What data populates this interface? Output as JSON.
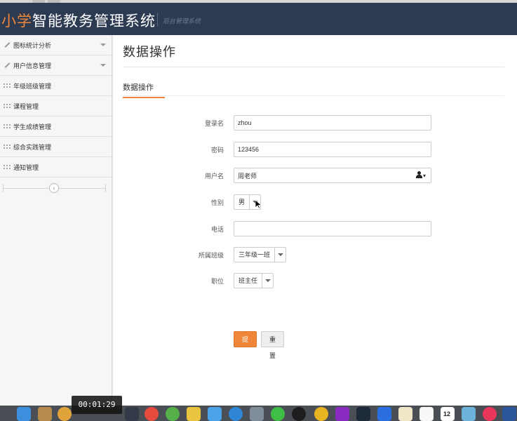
{
  "header": {
    "title_highlight": "小学",
    "title_rest": "智能教务管理系统",
    "subtitle": "后台管理系统"
  },
  "sidebar": {
    "items": [
      {
        "label": "图标统计分析",
        "icon": "pencil-icon",
        "has_arrow": true
      },
      {
        "label": "用户信息管理",
        "icon": "pencil-icon",
        "has_arrow": true
      },
      {
        "label": "年级班级管理",
        "icon": "grid-icon",
        "has_arrow": false
      },
      {
        "label": "课程管理",
        "icon": "grid-icon",
        "has_arrow": false
      },
      {
        "label": "学生成绩管理",
        "icon": "grid-icon",
        "has_arrow": false
      },
      {
        "label": "综合实践管理",
        "icon": "grid-icon",
        "has_arrow": false
      },
      {
        "label": "通知管理",
        "icon": "grid-icon",
        "has_arrow": false
      }
    ],
    "collapse_glyph": "‹"
  },
  "main": {
    "page_title": "数据操作",
    "section_tab": "数据操作"
  },
  "form": {
    "login_label": "登录名",
    "login_value": "zhou",
    "password_label": "密码",
    "password_value": "123456",
    "username_label": "用户名",
    "username_value": "周老师",
    "gender_label": "性别",
    "gender_value": "男",
    "phone_label": "电话",
    "phone_value": "",
    "class_label": "所属班级",
    "class_value": "三年级一班",
    "position_label": "职位",
    "position_value": "班主任"
  },
  "buttons": {
    "submit": "提交",
    "reset": "重置"
  },
  "video": {
    "timestamp": "00:01:29"
  },
  "dock": {
    "calendar_day": "12",
    "colors": {
      "finder": "#3b8fdc",
      "chrome": "#e54b3c",
      "accent": "#f0863a"
    }
  }
}
